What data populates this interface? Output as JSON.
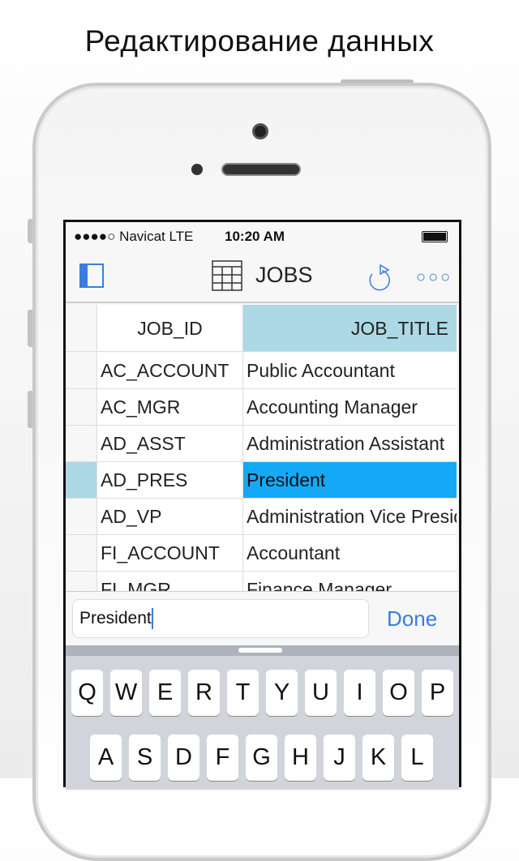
{
  "headline": "Редактирование данных",
  "status": {
    "carrier": "●●●●○ Navicat LTE",
    "time": "10:20 AM"
  },
  "nav": {
    "title": "JOBS",
    "icons": [
      "sidebar-toggle-icon",
      "table-icon",
      "refresh-icon",
      "more-icon"
    ],
    "more": "○○○"
  },
  "table": {
    "headers": [
      "JOB_ID",
      "JOB_TITLE"
    ],
    "rows": [
      {
        "id": "AC_ACCOUNT",
        "title": "Public Accountant"
      },
      {
        "id": "AC_MGR",
        "title": "Accounting Manager"
      },
      {
        "id": "AD_ASST",
        "title": "Administration Assistant"
      },
      {
        "id": "AD_PRES",
        "title": "President",
        "selected": true
      },
      {
        "id": "AD_VP",
        "title": "Administration Vice President"
      },
      {
        "id": "FI_ACCOUNT",
        "title": "Accountant"
      },
      {
        "id": "FI_MGR",
        "title": "Finance Manager"
      }
    ]
  },
  "editor": {
    "value": "President",
    "done": "Done"
  },
  "keyboard": {
    "row1": [
      "Q",
      "W",
      "E",
      "R",
      "T",
      "Y",
      "U",
      "I",
      "O",
      "P"
    ],
    "row2": [
      "A",
      "S",
      "D",
      "F",
      "G",
      "H",
      "J",
      "K",
      "L"
    ]
  },
  "colors": {
    "accent": "#3a7ce0",
    "selected_cell": "#14a9f7",
    "header_highlight": "#add8e6"
  }
}
